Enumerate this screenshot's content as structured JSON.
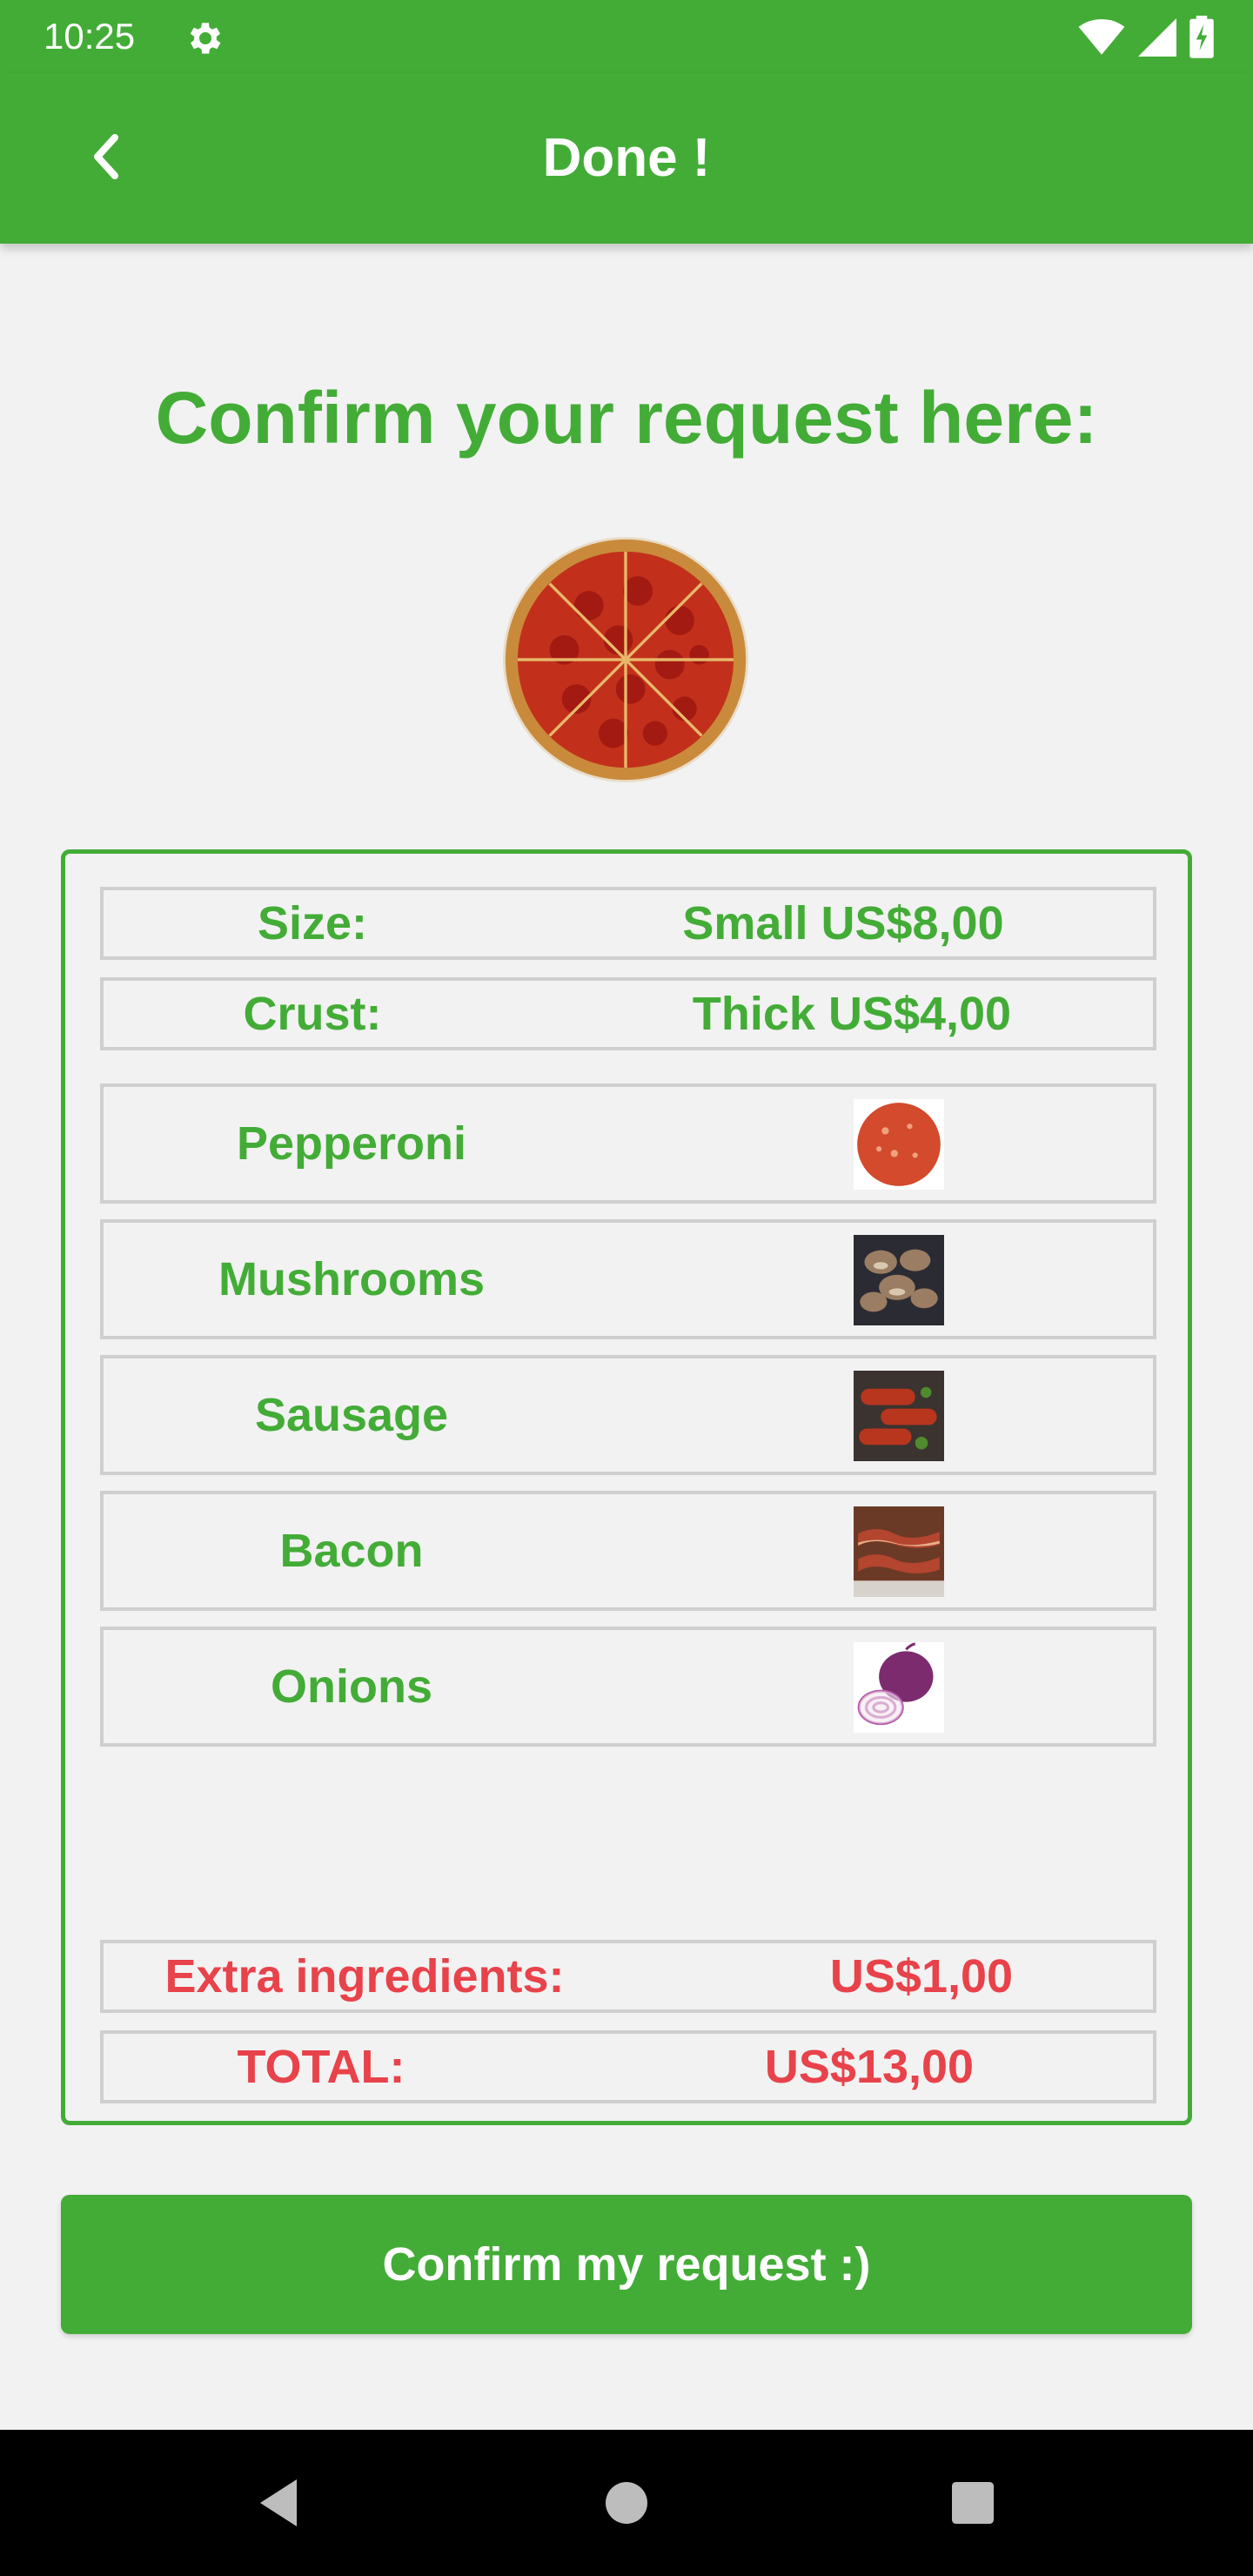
{
  "status_bar": {
    "time": "10:25",
    "icons": [
      "settings-gear-icon",
      "wifi-icon",
      "cell-signal-icon",
      "battery-icon"
    ]
  },
  "app_bar": {
    "title": "Done !",
    "back_icon": "chevron-left-icon",
    "color": "#43ac37"
  },
  "main": {
    "headline": "Confirm your request here:",
    "pizza_image": "pepperoni-pizza-image"
  },
  "summary": {
    "size": {
      "label": "Size:",
      "value": "Small US$8,00"
    },
    "crust": {
      "label": "Crust:",
      "value": "Thick US$4,00"
    },
    "ingredients": [
      {
        "name": "Pepperoni",
        "image": "pepperoni-image"
      },
      {
        "name": "Mushrooms",
        "image": "mushrooms-image"
      },
      {
        "name": "Sausage",
        "image": "sausage-image"
      },
      {
        "name": "Bacon",
        "image": "bacon-image"
      },
      {
        "name": "Onions",
        "image": "onions-image"
      }
    ],
    "extra": {
      "label": "Extra ingredients:",
      "value": "US$1,00"
    },
    "total": {
      "label": "TOTAL:",
      "value": "US$13,00"
    }
  },
  "confirm_button": {
    "label": "Confirm my request :)"
  },
  "nav_bar": {
    "icons": [
      "back-triangle-icon",
      "home-circle-icon",
      "recents-square-icon"
    ]
  },
  "colors": {
    "accent": "#43ac37",
    "price_red": "#e8424a",
    "background": "#f2f2f2"
  }
}
